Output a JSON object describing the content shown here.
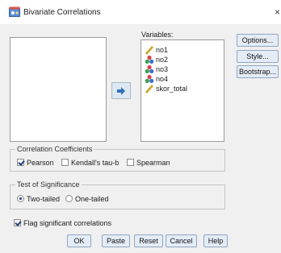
{
  "window": {
    "title": "Bivariate Correlations",
    "close_glyph": "×",
    "app_icon": "spss-dialog-icon"
  },
  "variables": {
    "label": "Variables:",
    "items": [
      {
        "name": "no1",
        "icon": "scale-ruler-icon"
      },
      {
        "name": "no2",
        "icon": "nominal-icon"
      },
      {
        "name": "no3",
        "icon": "nominal-icon"
      },
      {
        "name": "no4",
        "icon": "nominal-icon"
      },
      {
        "name": "skor_total",
        "icon": "scale-ruler-icon"
      }
    ]
  },
  "move_button": {
    "icon": "right-arrow-icon"
  },
  "side_buttons": {
    "options": "Options...",
    "style": "Style...",
    "bootstrap": "Bootstrap..."
  },
  "correlation": {
    "legend": "Correlation Coefficients",
    "pearson": {
      "label": "Pearson",
      "checked": true
    },
    "kendall": {
      "label": "Kendall's tau-b",
      "checked": false
    },
    "spearman": {
      "label": "Spearman",
      "checked": false
    }
  },
  "significance": {
    "legend": "Test of Significance",
    "two_tailed": {
      "label": "Two-tailed",
      "selected": true
    },
    "one_tailed": {
      "label": "One-tailed",
      "selected": false
    }
  },
  "flag": {
    "label": "Flag significant correlations",
    "checked": true
  },
  "bottom_buttons": {
    "ok": "OK",
    "paste": "Paste",
    "reset": "Reset",
    "cancel": "Cancel",
    "help": "Help"
  },
  "colors": {
    "accent": "#1e3f78",
    "button_bg": "#e4ecf6",
    "dialog_bg": "#f0f0f0"
  }
}
